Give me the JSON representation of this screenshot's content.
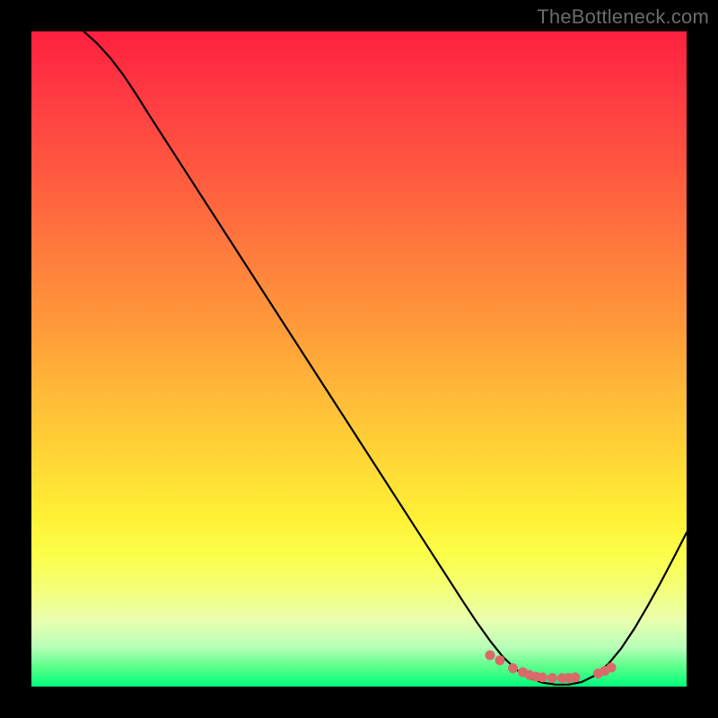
{
  "watermark": "TheBottleneck.com",
  "colors": {
    "curve": "#000000",
    "markers": "#d96a6a"
  },
  "chart_data": {
    "type": "line",
    "title": "",
    "xlabel": "",
    "ylabel": "",
    "xlim": [
      0,
      100
    ],
    "ylim": [
      0,
      100
    ],
    "x": [
      8,
      10,
      12,
      14,
      16,
      18,
      20,
      22,
      24,
      26,
      28,
      30,
      32,
      34,
      36,
      38,
      40,
      42,
      44,
      46,
      48,
      50,
      52,
      54,
      56,
      58,
      60,
      62,
      64,
      66,
      68,
      70,
      72,
      74,
      76,
      78,
      80,
      82,
      84,
      86,
      88,
      90,
      92,
      94,
      96,
      98,
      100
    ],
    "y": [
      100,
      98.2,
      96.0,
      93.4,
      90.4,
      87.2,
      84.1,
      81.0,
      77.9,
      74.8,
      71.7,
      68.6,
      65.5,
      62.4,
      59.3,
      56.2,
      53.1,
      50.0,
      46.9,
      43.8,
      40.7,
      37.6,
      34.5,
      31.4,
      28.3,
      25.2,
      22.1,
      19.0,
      15.9,
      12.8,
      9.8,
      7.0,
      4.5,
      2.6,
      1.3,
      0.6,
      0.3,
      0.3,
      0.7,
      1.7,
      3.4,
      5.8,
      8.8,
      12.2,
      15.8,
      19.6,
      23.5
    ],
    "markers": {
      "x": [
        70,
        71.5,
        73.5,
        75,
        76,
        77,
        78,
        79.5,
        81,
        82,
        83,
        86.5,
        87.5,
        88.5
      ],
      "y": [
        4.8,
        4.0,
        2.8,
        2.2,
        1.8,
        1.5,
        1.4,
        1.3,
        1.3,
        1.3,
        1.4,
        2.0,
        2.4,
        2.9
      ]
    }
  }
}
